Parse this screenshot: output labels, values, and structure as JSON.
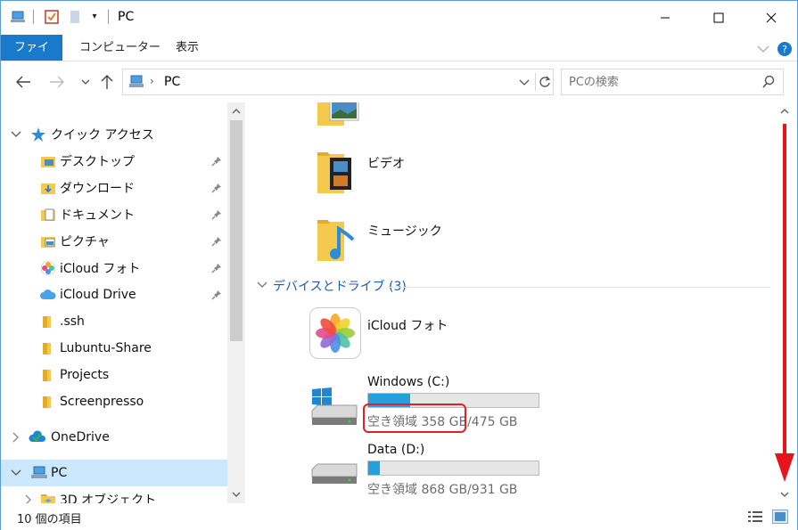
{
  "window": {
    "title": "PC"
  },
  "ribbon": {
    "tabs": [
      {
        "label": "ファイル",
        "active": true
      },
      {
        "label": "コンピューター",
        "active": false
      },
      {
        "label": "表示",
        "active": false
      }
    ]
  },
  "address": {
    "path": "PC",
    "search_placeholder": "PCの検索"
  },
  "navpane": {
    "quick_access": "クイック アクセス",
    "items": [
      {
        "label": "デスクトップ",
        "icon": "desktop-icon",
        "pinned": true
      },
      {
        "label": "ダウンロード",
        "icon": "download-icon",
        "pinned": true
      },
      {
        "label": "ドキュメント",
        "icon": "document-icon",
        "pinned": true
      },
      {
        "label": "ピクチャ",
        "icon": "picture-icon",
        "pinned": true
      },
      {
        "label": "iCloud フォト",
        "icon": "icloud-photos-icon",
        "pinned": true
      },
      {
        "label": "iCloud Drive",
        "icon": "icloud-drive-icon",
        "pinned": true
      },
      {
        "label": ".ssh",
        "icon": "folder-icon",
        "pinned": false
      },
      {
        "label": "Lubuntu-Share",
        "icon": "folder-icon",
        "pinned": false
      },
      {
        "label": "Projects",
        "icon": "folder-icon",
        "pinned": false
      },
      {
        "label": "Screenpresso",
        "icon": "folder-icon",
        "pinned": false
      }
    ],
    "onedrive": "OneDrive",
    "pc": "PC",
    "objects3d": "3D オブジェクト"
  },
  "content": {
    "videos": "ビデオ",
    "music": "ミュージック",
    "group_header": "デバイスとドライブ (3)",
    "icloud_photos": "iCloud フォト",
    "drives": [
      {
        "name": "Windows (C:)",
        "free": "空き領域 358 GB/475 GB",
        "used_fraction": 0.246
      },
      {
        "name": "Data (D:)",
        "free": "空き領域 868 GB/931 GB",
        "used_fraction": 0.068
      }
    ]
  },
  "status": {
    "count": "10 個の項目"
  },
  "colors": {
    "accent": "#1979ca",
    "selection": "#cce8ff",
    "drive_fill": "#26a0da",
    "annotation": "#e0202a"
  }
}
